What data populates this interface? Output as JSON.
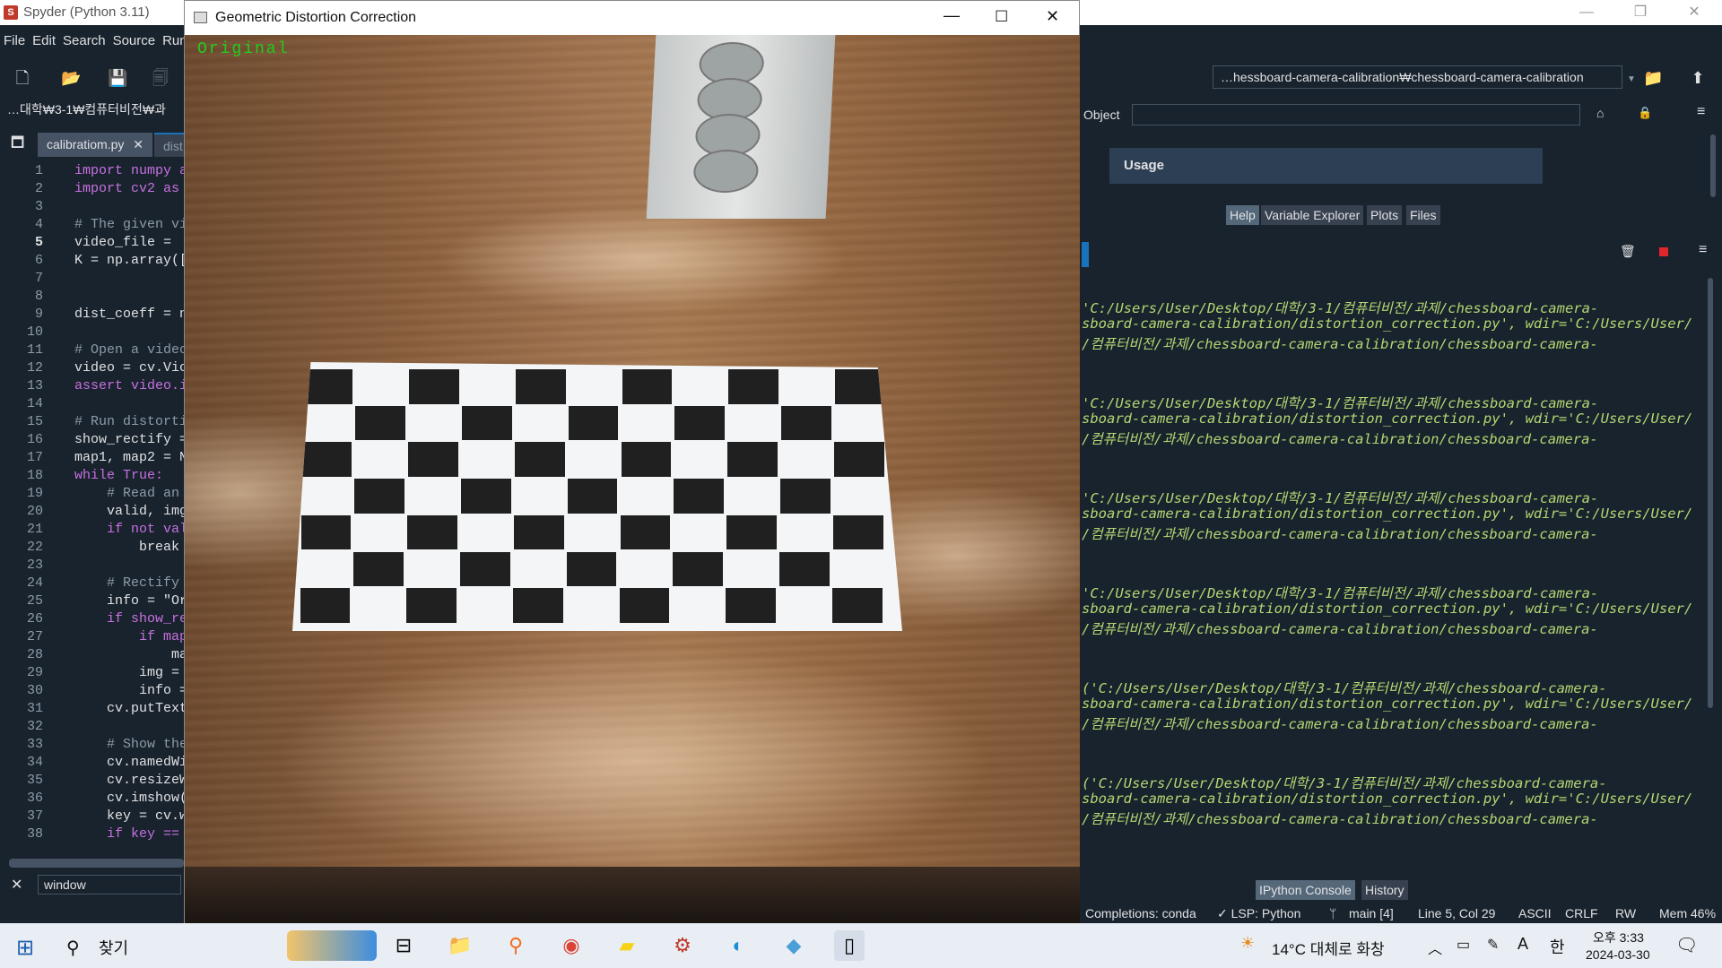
{
  "app": {
    "title": "Spyder (Python 3.11)"
  },
  "menu": [
    "File",
    "Edit",
    "Search",
    "Source",
    "Run"
  ],
  "toolbar": {
    "path": "…hessboard-camera-calibration₩chessboard-camera-calibration"
  },
  "breadcrumb": "…대학₩3-1₩컴퓨터비전₩과",
  "editor": {
    "tabs": [
      {
        "label": "calibratiom.py"
      },
      {
        "label": "dist"
      }
    ],
    "lines": [
      {
        "n": "1",
        "t": "import numpy a"
      },
      {
        "n": "2",
        "t": "import cv2 as"
      },
      {
        "n": "3",
        "t": ""
      },
      {
        "n": "4",
        "t": "# The given vi"
      },
      {
        "n": "5",
        "t": "video_file ="
      },
      {
        "n": "6",
        "t": "K = np.array(["
      },
      {
        "n": "7",
        "t": ""
      },
      {
        "n": "8",
        "t": ""
      },
      {
        "n": "9",
        "t": "dist_coeff = n"
      },
      {
        "n": "10",
        "t": ""
      },
      {
        "n": "11",
        "t": "# Open a video"
      },
      {
        "n": "12",
        "t": "video = cv.Vic"
      },
      {
        "n": "13",
        "t": "assert video.i"
      },
      {
        "n": "14",
        "t": ""
      },
      {
        "n": "15",
        "t": "# Run distorti"
      },
      {
        "n": "16",
        "t": "show_rectify ="
      },
      {
        "n": "17",
        "t": "map1, map2 = N"
      },
      {
        "n": "18",
        "t": "while True:"
      },
      {
        "n": "19",
        "t": "    # Read an"
      },
      {
        "n": "20",
        "t": "    valid, img"
      },
      {
        "n": "21",
        "t": "    if not val"
      },
      {
        "n": "22",
        "t": "        break"
      },
      {
        "n": "23",
        "t": ""
      },
      {
        "n": "24",
        "t": "    # Rectify"
      },
      {
        "n": "25",
        "t": "    info = \"Or"
      },
      {
        "n": "26",
        "t": "    if show_re"
      },
      {
        "n": "27",
        "t": "        if map"
      },
      {
        "n": "28",
        "t": "            ma"
      },
      {
        "n": "29",
        "t": "        img ="
      },
      {
        "n": "30",
        "t": "        info ="
      },
      {
        "n": "31",
        "t": "    cv.putText"
      },
      {
        "n": "32",
        "t": ""
      },
      {
        "n": "33",
        "t": "    # Show the"
      },
      {
        "n": "34",
        "t": "    cv.namedWi"
      },
      {
        "n": "35",
        "t": "    cv.resizeW"
      },
      {
        "n": "36",
        "t": "    cv.imshow("
      },
      {
        "n": "37",
        "t": "    key = cv.w"
      },
      {
        "n": "38",
        "t": "    if key =="
      }
    ],
    "find_value": "window"
  },
  "cvwindow": {
    "title": "Geometric Distortion Correction",
    "overlay_text": "Original"
  },
  "help": {
    "object_label": "Object",
    "usage_title": "Usage",
    "tabs": [
      "Help",
      "Variable Explorer",
      "Plots",
      "Files"
    ]
  },
  "console": {
    "lines": [
      "'C:/Users/User/Desktop/대학/3-1/컴퓨터비전/과제/chessboard-camera-",
      "sboard-camera-calibration/distortion_correction.py', wdir='C:/Users/User/",
      "/컴퓨터비전/과제/chessboard-camera-calibration/chessboard-camera-",
      "'C:/Users/User/Desktop/대학/3-1/컴퓨터비전/과제/chessboard-camera-",
      "sboard-camera-calibration/distortion_correction.py', wdir='C:/Users/User/",
      "/컴퓨터비전/과제/chessboard-camera-calibration/chessboard-camera-",
      "'C:/Users/User/Desktop/대학/3-1/컴퓨터비전/과제/chessboard-camera-",
      "sboard-camera-calibration/distortion_correction.py', wdir='C:/Users/User/",
      "/컴퓨터비전/과제/chessboard-camera-calibration/chessboard-camera-",
      "'C:/Users/User/Desktop/대학/3-1/컴퓨터비전/과제/chessboard-camera-",
      "sboard-camera-calibration/distortion_correction.py', wdir='C:/Users/User/",
      "/컴퓨터비전/과제/chessboard-camera-calibration/chessboard-camera-",
      "('C:/Users/User/Desktop/대학/3-1/컴퓨터비전/과제/chessboard-camera-",
      "sboard-camera-calibration/distortion_correction.py', wdir='C:/Users/User/",
      "/컴퓨터비전/과제/chessboard-camera-calibration/chessboard-camera-",
      "('C:/Users/User/Desktop/대학/3-1/컴퓨터비전/과제/chessboard-camera-",
      "sboard-camera-calibration/distortion_correction.py', wdir='C:/Users/User/",
      "/컴퓨터비전/과제/chessboard-camera-calibration/chessboard-camera-"
    ],
    "tabs": [
      "IPython Console",
      "History"
    ]
  },
  "status": {
    "completions": "Completions: conda",
    "lsp": "✓ LSP: Python",
    "git": "main [4]",
    "position": "Line 5, Col 29",
    "encoding": "ASCII",
    "eol": "CRLF",
    "rw": "RW",
    "mem": "Mem 46%"
  },
  "taskbar": {
    "search": "찾기",
    "weather": "14°C 대체로 화창",
    "ime_a": "A",
    "ime_han": "한",
    "time": "오후 3:33",
    "date": "2024-03-30"
  }
}
